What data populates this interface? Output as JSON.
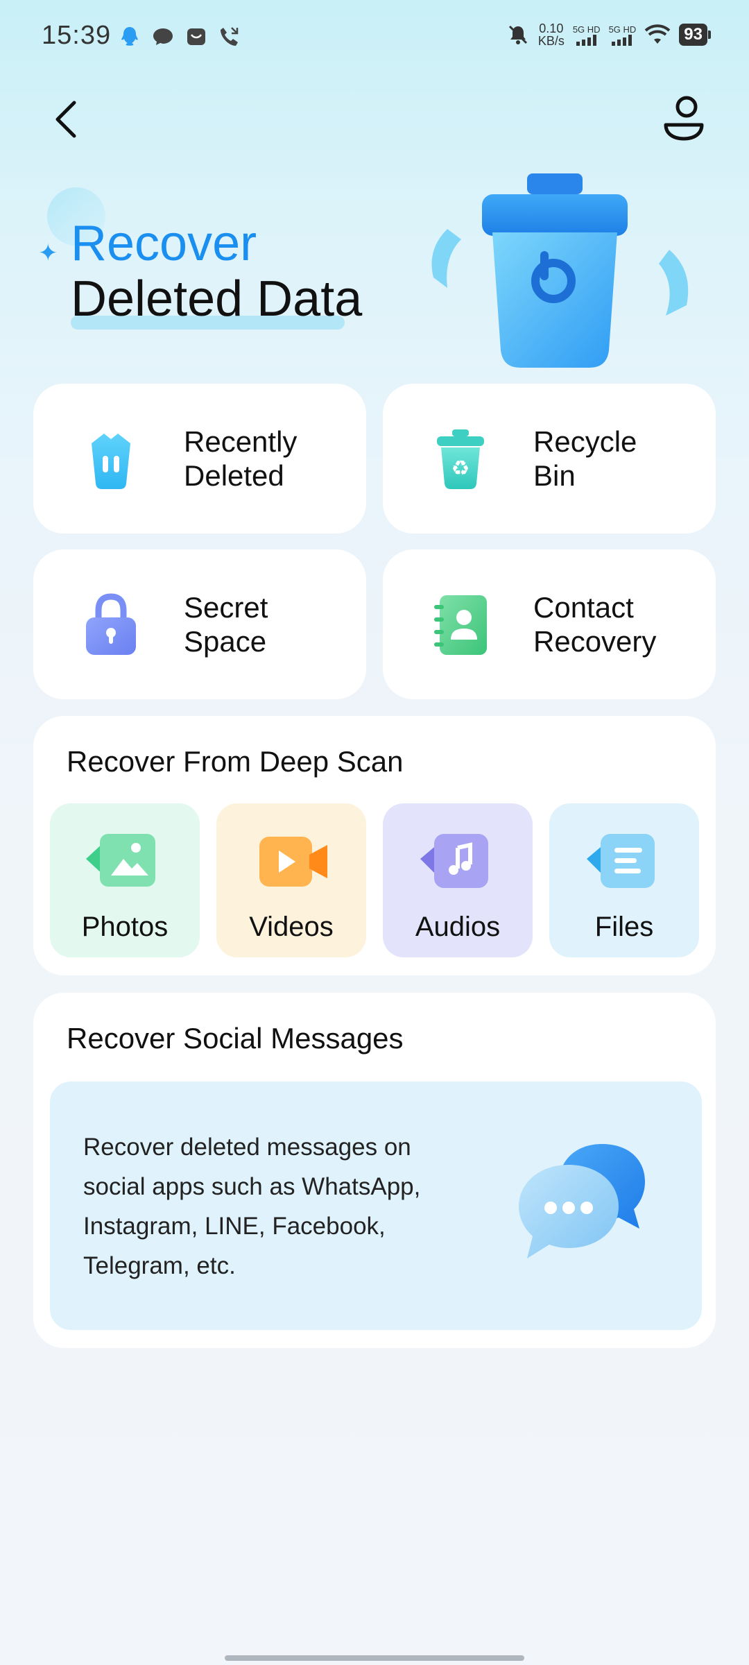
{
  "status_bar": {
    "time": "15:39",
    "net_speed_value": "0.10",
    "net_speed_unit": "KB/s",
    "sim1": "5G HD",
    "sim2": "5G HD",
    "battery": "93"
  },
  "header": {
    "title_line1": "Recover",
    "title_line2": "Deleted Data"
  },
  "quick_actions": [
    {
      "line1": "Recently",
      "line2": "Deleted"
    },
    {
      "line1": "Recycle",
      "line2": "Bin"
    },
    {
      "line1": "Secret",
      "line2": "Space"
    },
    {
      "line1": "Contact",
      "line2": "Recovery"
    }
  ],
  "deep_scan": {
    "title": "Recover From Deep Scan",
    "items": [
      {
        "label": "Photos",
        "bg": "#e3f8ef",
        "accent": "#3fcf8a"
      },
      {
        "label": "Videos",
        "bg": "#fdf2dc",
        "accent": "#ff9a2e"
      },
      {
        "label": "Audios",
        "bg": "#e3e4fb",
        "accent": "#8a86ec"
      },
      {
        "label": "Files",
        "bg": "#e0f2fb",
        "accent": "#3db8ef"
      }
    ]
  },
  "social": {
    "title": "Recover Social Messages",
    "description": "Recover deleted messages on social apps such as WhatsApp, Instagram, LINE, Facebook, Telegram, etc."
  },
  "colors": {
    "accent_blue": "#1a8ff0",
    "card_bg": "#ffffff"
  },
  "icons": {
    "back": "chevron-left-icon",
    "profile": "user-icon",
    "recently_deleted": "trash-pause-icon",
    "recycle_bin": "recycle-bin-icon",
    "secret_space": "lock-icon",
    "contact_recovery": "contact-book-icon",
    "photos": "photo-icon",
    "videos": "video-icon",
    "audios": "music-icon",
    "files": "file-icon",
    "social": "chat-bubbles-icon"
  }
}
